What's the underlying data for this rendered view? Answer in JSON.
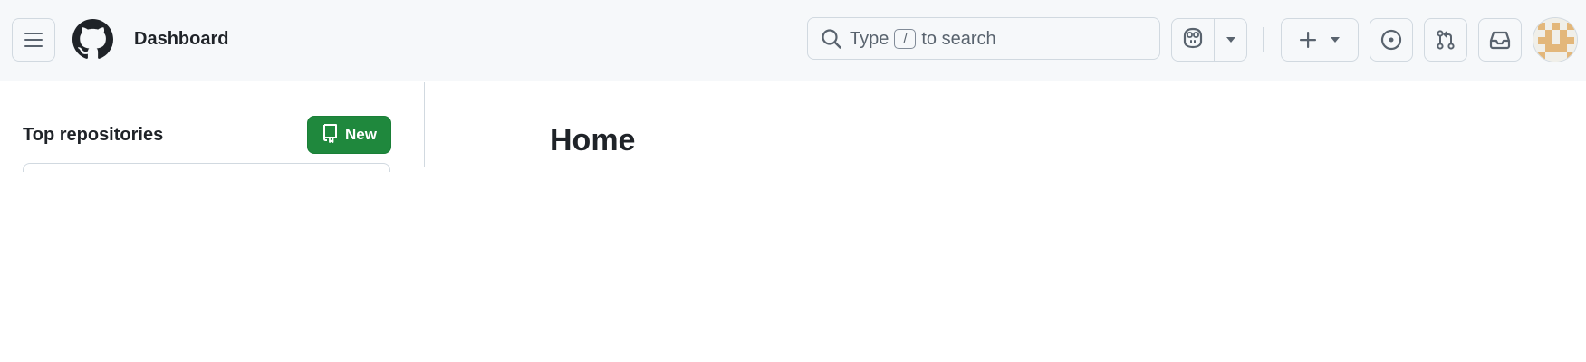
{
  "header": {
    "title": "Dashboard",
    "search": {
      "prefix": "Type",
      "shortcut": "/",
      "suffix": "to search"
    },
    "icons": {
      "menu": "hamburger-icon",
      "logo": "github-mark-icon",
      "search": "search-icon",
      "copilot": "copilot-icon",
      "copilot_menu": "triangle-down-icon",
      "create": "plus-icon",
      "create_menu": "triangle-down-icon",
      "issues": "issue-opened-icon",
      "pulls": "git-pull-request-icon",
      "inbox": "inbox-icon",
      "avatar": "identicon-avatar"
    }
  },
  "sidebar": {
    "heading": "Top repositories",
    "new_button_label": "New",
    "new_button_icon": "repo-icon"
  },
  "main": {
    "title": "Home"
  },
  "colors": {
    "header_bg": "#f6f8fa",
    "border": "#d1d9e0",
    "primary_button": "#1f883d",
    "text": "#1f2328",
    "muted": "#59636e",
    "avatar_accent": "#e3b77a"
  }
}
